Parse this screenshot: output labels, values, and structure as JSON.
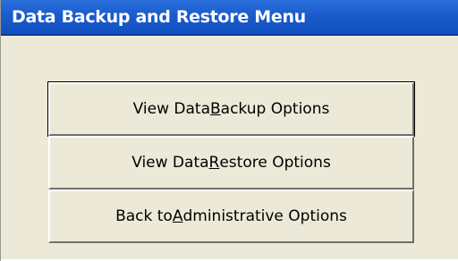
{
  "window": {
    "title": "Data Backup and Restore Menu"
  },
  "buttons": [
    {
      "pre": "View Data ",
      "mnemonic": "B",
      "post": "ackup Options",
      "default": true
    },
    {
      "pre": "View Data ",
      "mnemonic": "R",
      "post": "estore Options",
      "default": false
    },
    {
      "pre": "Back to ",
      "mnemonic": "A",
      "post": "dministrative Options",
      "default": false
    }
  ]
}
